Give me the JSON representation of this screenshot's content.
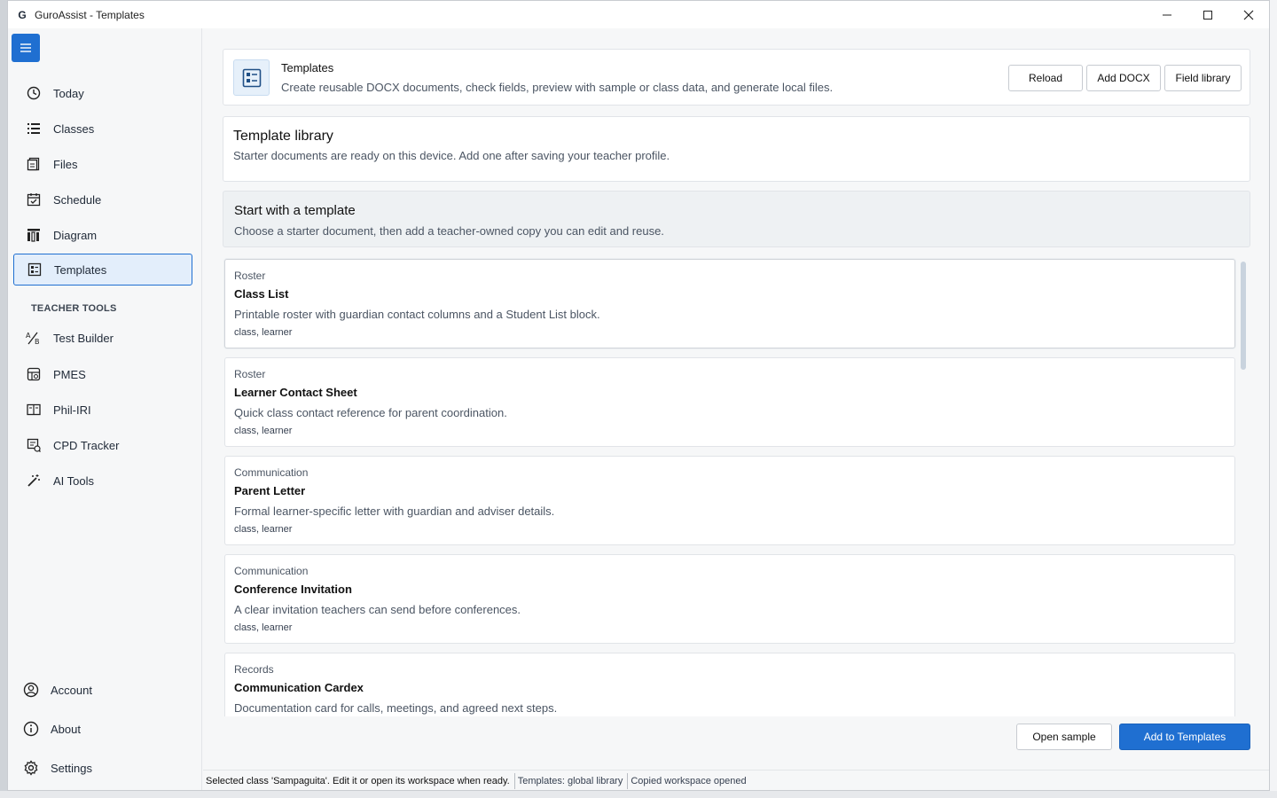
{
  "window": {
    "title": "GuroAssist - Templates",
    "logo_letter": "G"
  },
  "sidebar": {
    "items": [
      {
        "label": "Today",
        "icon": "clock-icon"
      },
      {
        "label": "Classes",
        "icon": "list-icon"
      },
      {
        "label": "Files",
        "icon": "files-icon"
      },
      {
        "label": "Schedule",
        "icon": "calendar-icon"
      },
      {
        "label": "Diagram",
        "icon": "diagram-icon"
      },
      {
        "label": "Templates",
        "icon": "template-icon",
        "active": true
      }
    ],
    "section_label": "TEACHER TOOLS",
    "tools": [
      {
        "label": "Test Builder",
        "icon": "test-builder-icon"
      },
      {
        "label": "PMES",
        "icon": "pmes-icon"
      },
      {
        "label": "Phil-IRI",
        "icon": "book-icon"
      },
      {
        "label": "CPD Tracker",
        "icon": "tracker-icon"
      },
      {
        "label": "AI Tools",
        "icon": "magic-wand-icon"
      }
    ],
    "bottom": [
      {
        "label": "Account",
        "icon": "account-icon"
      },
      {
        "label": "About",
        "icon": "info-icon"
      },
      {
        "label": "Settings",
        "icon": "gear-icon"
      }
    ]
  },
  "header": {
    "title": "Templates",
    "subtitle": "Create reusable DOCX documents, check fields, preview with sample or class data, and generate local files.",
    "buttons": {
      "reload": "Reload",
      "add_docx": "Add DOCX",
      "field_library": "Field library"
    }
  },
  "library": {
    "title": "Template library",
    "subtitle": "Starter documents are ready on this device. Add one after saving your teacher profile."
  },
  "start": {
    "title": "Start with a template",
    "subtitle": "Choose a starter document, then add a teacher-owned copy you can edit and reuse."
  },
  "templates": [
    {
      "category": "Roster",
      "name": "Class List",
      "description": "Printable roster with guardian contact columns and a Student List block.",
      "tags": "class, learner"
    },
    {
      "category": "Roster",
      "name": "Learner Contact Sheet",
      "description": "Quick class contact reference for parent coordination.",
      "tags": "class, learner"
    },
    {
      "category": "Communication",
      "name": "Parent Letter",
      "description": "Formal learner-specific letter with guardian and adviser details.",
      "tags": "class, learner"
    },
    {
      "category": "Communication",
      "name": "Conference Invitation",
      "description": "A clear invitation teachers can send before conferences.",
      "tags": "class, learner"
    },
    {
      "category": "Records",
      "name": "Communication Cardex",
      "description": "Documentation card for calls, meetings, and agreed next steps.",
      "tags": ""
    }
  ],
  "actions": {
    "open_sample": "Open sample",
    "add_to_templates": "Add to Templates"
  },
  "status": {
    "message": "Selected class 'Sampaguita'. Edit it or open its workspace when ready.",
    "templates": "Templates: global library",
    "workspace": "Copied workspace opened"
  },
  "colors": {
    "accent": "#1f6fd1",
    "active_bg": "#e3eefb"
  }
}
